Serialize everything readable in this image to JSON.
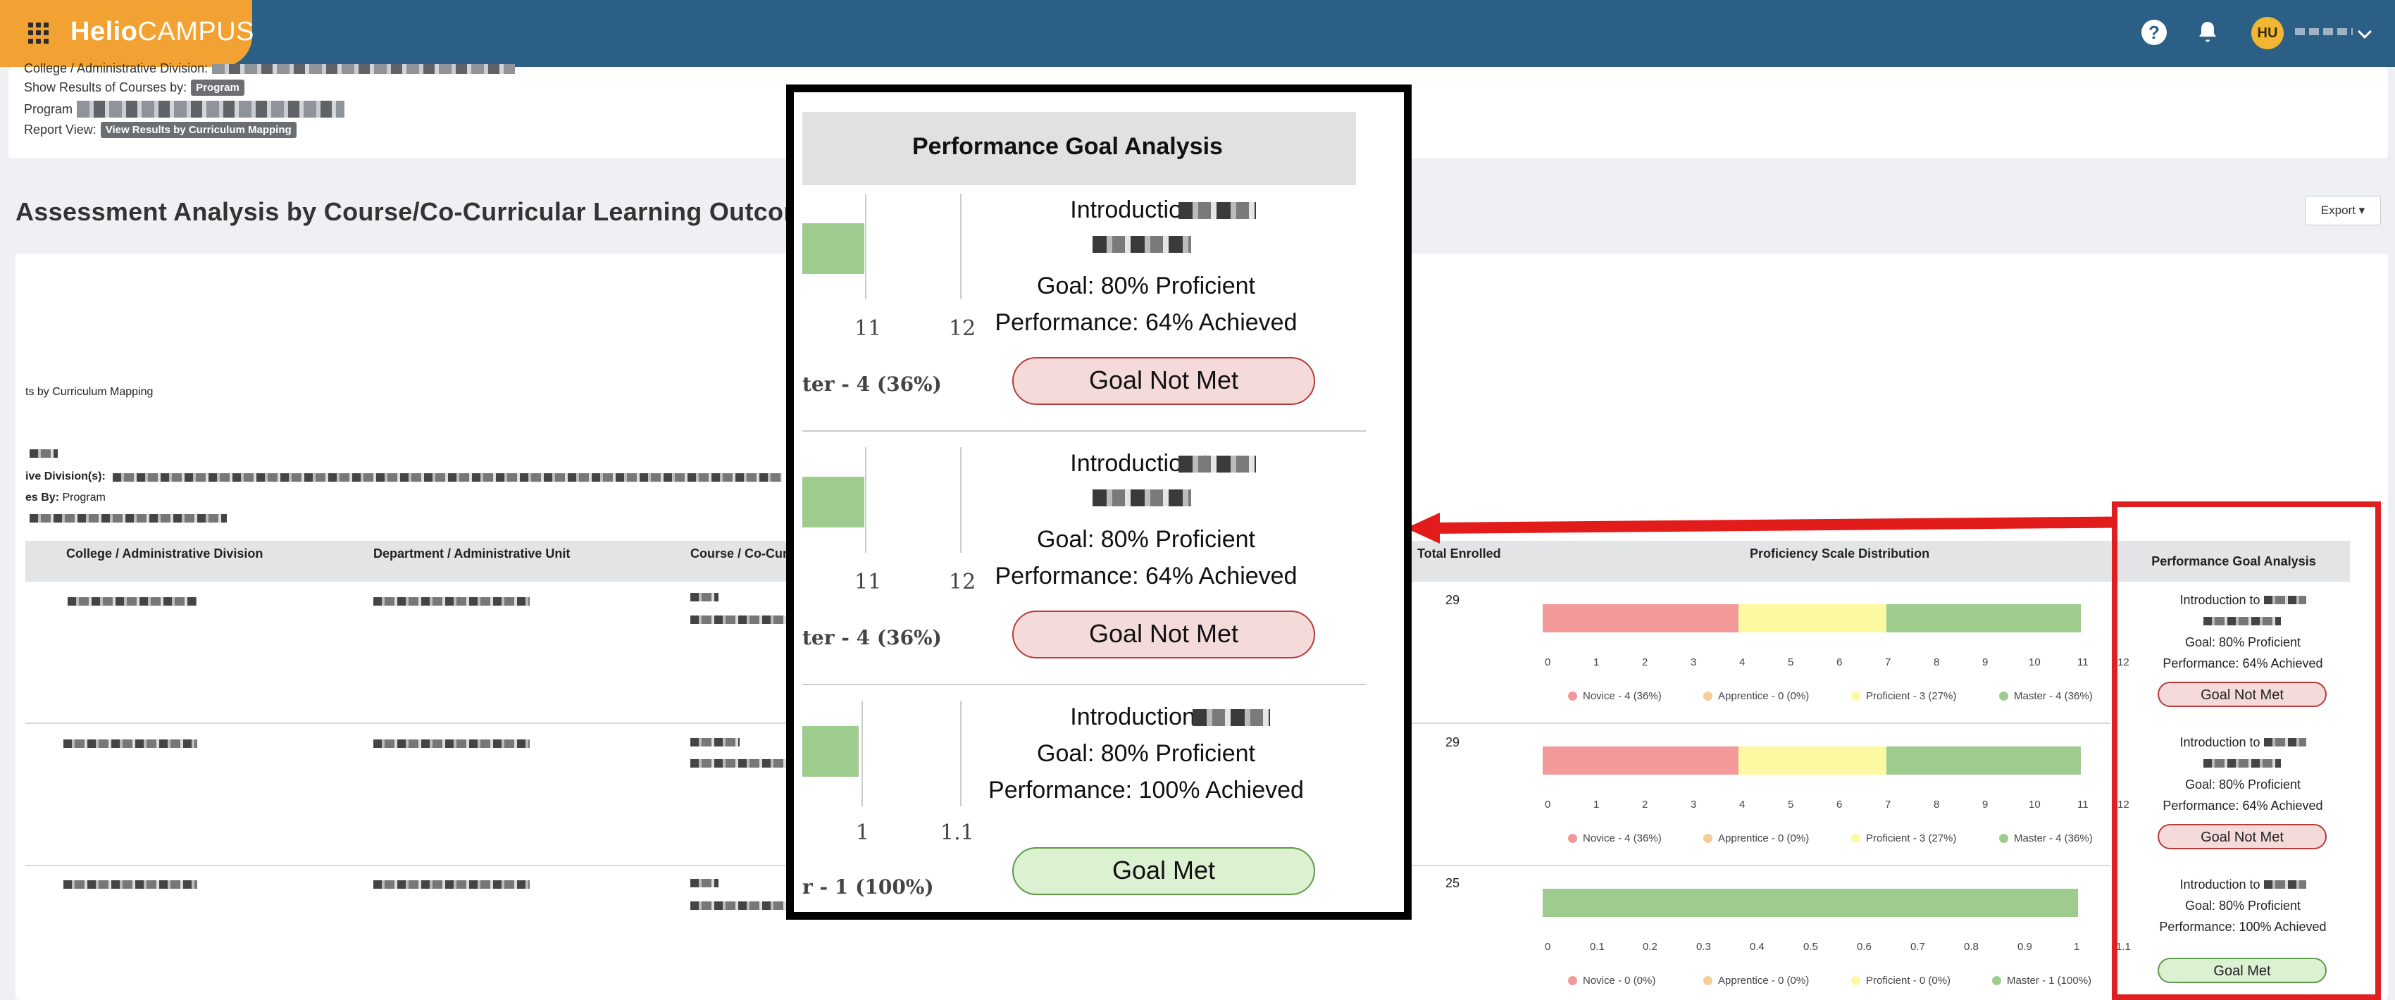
{
  "header": {
    "logo_bold": "Helio",
    "logo_rest": "CAMPUS",
    "help_label": "?",
    "user_initials": "HU"
  },
  "filters": {
    "college_label": "College / Administrative Division:",
    "show_results_label": "Show Results of Courses by:",
    "show_results_value": "Program",
    "program_label": "Program",
    "report_view_label": "Report View:",
    "report_view_value": "View Results by Curriculum Mapping"
  },
  "section_title": "Assessment Analysis by Course/Co-Curricular Learning Outcom",
  "export_label": "Export ▾",
  "report_meta": {
    "mapping_line": "ts by Curriculum Mapping",
    "division_label": "ive Division(s):",
    "results_by_label": "es By:",
    "results_by_value": "Program"
  },
  "table": {
    "columns": [
      "College / Administrative Division",
      "Department / Administrative Unit",
      "Course / Co-Curi",
      "Total Enrolled",
      "Proficiency Scale Distribution",
      "Performance Goal Analysis"
    ],
    "rows": [
      {
        "enrolled": "29",
        "ticks": [
          "0",
          "1",
          "2",
          "3",
          "4",
          "5",
          "6",
          "7",
          "8",
          "9",
          "10",
          "11",
          "12"
        ],
        "legend": [
          "Novice - 4 (36%)",
          "Apprentice - 0 (0%)",
          "Proficient - 3 (27%)",
          "Master - 4 (36%)"
        ],
        "goal_intro": "Introduction to",
        "goal_target": "Goal: 80% Proficient",
        "goal_perf": "Performance: 64% Achieved",
        "goal_status": "Goal Not Met"
      },
      {
        "enrolled": "29",
        "ticks": [
          "0",
          "1",
          "2",
          "3",
          "4",
          "5",
          "6",
          "7",
          "8",
          "9",
          "10",
          "11",
          "12"
        ],
        "legend": [
          "Novice - 4 (36%)",
          "Apprentice - 0 (0%)",
          "Proficient - 3 (27%)",
          "Master - 4 (36%)"
        ],
        "goal_intro": "Introduction to",
        "goal_target": "Goal: 80% Proficient",
        "goal_perf": "Performance: 64% Achieved",
        "goal_status": "Goal Not Met"
      },
      {
        "enrolled": "25",
        "ticks": [
          "0",
          "0.1",
          "0.2",
          "0.3",
          "0.4",
          "0.5",
          "0.6",
          "0.7",
          "0.8",
          "0.9",
          "1",
          "1.1"
        ],
        "legend": [
          "Novice - 0 (0%)",
          "Apprentice - 0 (0%)",
          "Proficient - 0 (0%)",
          "Master - 1 (100%)"
        ],
        "goal_intro": "Introduction to",
        "goal_target": "Goal: 80% Proficient",
        "goal_perf": "Performance: 100% Achieved",
        "goal_status": "Goal Met"
      }
    ]
  },
  "zoom": {
    "title": "Performance Goal Analysis",
    "blocks": [
      {
        "intro": "Introduction to",
        "goal": "Goal: 80% Proficient",
        "perf": "Performance: 64% Achieved",
        "status": "Goal Not Met",
        "ticks": [
          "11",
          "12"
        ],
        "legend": "ter - 4 (36%)"
      },
      {
        "intro": "Introduction to",
        "goal": "Goal: 80% Proficient",
        "perf": "Performance: 64% Achieved",
        "status": "Goal Not Met",
        "ticks": [
          "11",
          "12"
        ],
        "legend": "ter - 4 (36%)"
      },
      {
        "intro": "Introduction to",
        "goal": "Goal: 80% Proficient",
        "perf": "Performance: 100% Achieved",
        "status": "Goal Met",
        "ticks": [
          "1",
          "1.1"
        ],
        "legend": "r - 1 (100%)"
      }
    ]
  },
  "colors": {
    "header_bg": "#2b5f86",
    "brand_orange": "#f2a233",
    "novice": "#f29a99",
    "apprentice": "#f5cd96",
    "proficient": "#fdf9a2",
    "master": "#9ecc8f",
    "highlight_red": "#e02020"
  }
}
